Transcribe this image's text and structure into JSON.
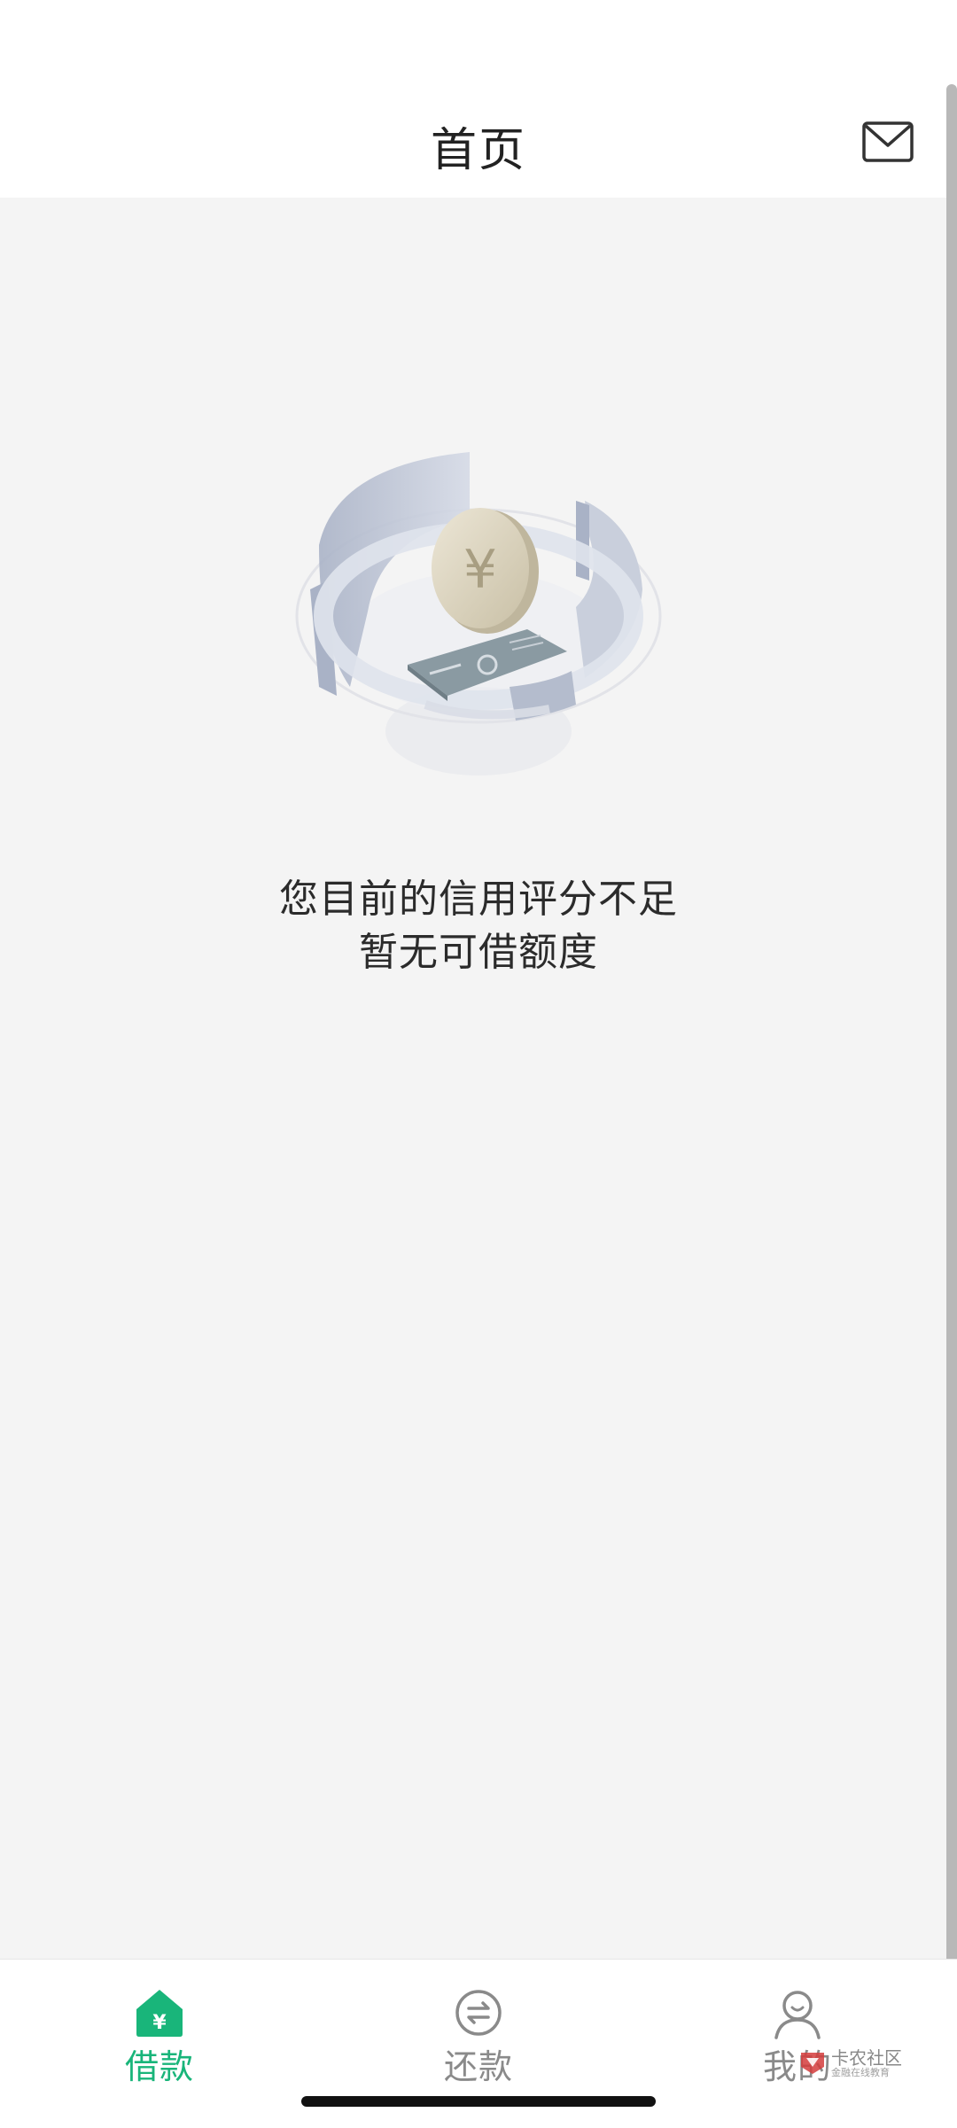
{
  "header": {
    "title": "首页",
    "mail_icon": "mail-icon"
  },
  "empty_state": {
    "illustration": "credit-illustration",
    "line1": "您目前的信用评分不足",
    "line2": "暂无可借额度"
  },
  "tabs": [
    {
      "label": "借款",
      "icon": "loan-home-icon",
      "active": true
    },
    {
      "label": "还款",
      "icon": "repay-exchange-icon",
      "active": false
    },
    {
      "label": "我的",
      "icon": "profile-icon",
      "active": false
    }
  ],
  "watermark": {
    "title": "卡农社区",
    "subtitle": "金融在线教育"
  },
  "colors": {
    "accent": "#19b57a",
    "background": "#f4f4f4",
    "text": "#2b2b2b",
    "inactive": "#8a8a8a"
  }
}
